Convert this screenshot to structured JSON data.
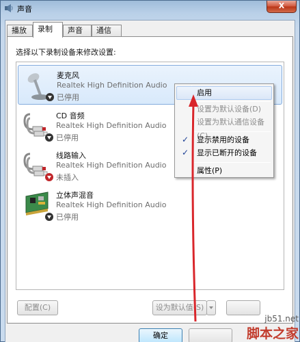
{
  "window": {
    "title": "声音",
    "close_label": "X"
  },
  "tabs": [
    {
      "label": "播放",
      "active": false
    },
    {
      "label": "录制",
      "active": true
    },
    {
      "label": "声音",
      "active": false
    },
    {
      "label": "通信",
      "active": false
    }
  ],
  "instruction": "选择以下录制设备来修改设置:",
  "devices": [
    {
      "name": "麦克风",
      "driver": "Realtek High Definition Audio",
      "status": "已停用",
      "icon": "microphone-icon",
      "selected": true
    },
    {
      "name": "CD 音频",
      "driver": "Realtek High Definition Audio",
      "status": "已停用",
      "icon": "rca-cable-icon",
      "selected": false
    },
    {
      "name": "线路输入",
      "driver": "Realtek High Definition Audio",
      "status": "未插入",
      "icon": "rca-cable-icon",
      "selected": false
    },
    {
      "name": "立体声混音",
      "driver": "Realtek High Definition Audio",
      "status": "已停用",
      "icon": "sound-card-icon",
      "selected": false
    }
  ],
  "context_menu": [
    {
      "label": "启用",
      "state": "hover"
    },
    {
      "label": "设置为默认设备(D)",
      "state": "disabled"
    },
    {
      "label": "设置为默认通信设备(C)",
      "state": "disabled"
    },
    {
      "label": "显示禁用的设备",
      "state": "checked"
    },
    {
      "label": "显示已断开的设备",
      "state": "checked"
    },
    {
      "label": "属性(P)",
      "state": "normal"
    }
  ],
  "buttons": {
    "configure": "配置(C)",
    "set_default": "设为默认值(S)",
    "ok": "确定"
  },
  "watermark": {
    "url": "jb51.net",
    "logo": "脚本之家"
  },
  "colors": {
    "annotation_arrow": "#d9262b",
    "check_mark": "#1c3f94"
  }
}
